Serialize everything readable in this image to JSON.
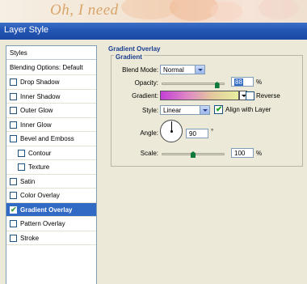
{
  "background": {
    "text": "Oh, I need"
  },
  "dialog": {
    "title": "Layer Style"
  },
  "sidebar": {
    "header": "Styles",
    "items": [
      {
        "label": "Blending Options: Default",
        "checkbox": false,
        "checked": false,
        "indent": false,
        "selected": false
      },
      {
        "label": "Drop Shadow",
        "checkbox": true,
        "checked": false,
        "indent": false,
        "selected": false
      },
      {
        "label": "Inner Shadow",
        "checkbox": true,
        "checked": false,
        "indent": false,
        "selected": false
      },
      {
        "label": "Outer Glow",
        "checkbox": true,
        "checked": false,
        "indent": false,
        "selected": false
      },
      {
        "label": "Inner Glow",
        "checkbox": true,
        "checked": false,
        "indent": false,
        "selected": false
      },
      {
        "label": "Bevel and Emboss",
        "checkbox": true,
        "checked": false,
        "indent": false,
        "selected": false
      },
      {
        "label": "Contour",
        "checkbox": true,
        "checked": false,
        "indent": true,
        "selected": false
      },
      {
        "label": "Texture",
        "checkbox": true,
        "checked": false,
        "indent": true,
        "selected": false
      },
      {
        "label": "Satin",
        "checkbox": true,
        "checked": false,
        "indent": false,
        "selected": false
      },
      {
        "label": "Color Overlay",
        "checkbox": true,
        "checked": false,
        "indent": false,
        "selected": false
      },
      {
        "label": "Gradient Overlay",
        "checkbox": true,
        "checked": true,
        "indent": false,
        "selected": true
      },
      {
        "label": "Pattern Overlay",
        "checkbox": true,
        "checked": false,
        "indent": false,
        "selected": false
      },
      {
        "label": "Stroke",
        "checkbox": true,
        "checked": false,
        "indent": false,
        "selected": false
      }
    ]
  },
  "gradient_overlay": {
    "title": "Gradient Overlay",
    "group_title": "Gradient",
    "blend_mode": {
      "label": "Blend Mode:",
      "value": "Normal"
    },
    "opacity": {
      "label": "Opacity:",
      "value": "88",
      "unit": "%",
      "fraction": 0.88
    },
    "gradient": {
      "label": "Gradient:",
      "colors": [
        "#c23fd6",
        "#de85c6",
        "#e3c99c",
        "#e8f0a0"
      ]
    },
    "reverse": {
      "label": "Reverse",
      "checked": false
    },
    "style": {
      "label": "Style:",
      "value": "Linear"
    },
    "align_with_layer": {
      "label": "Align with Layer",
      "checked": true
    },
    "angle": {
      "label": "Angle:",
      "value": "90",
      "unit": "°"
    },
    "scale": {
      "label": "Scale:",
      "value": "100",
      "unit": "%",
      "fraction": 0.5
    }
  }
}
